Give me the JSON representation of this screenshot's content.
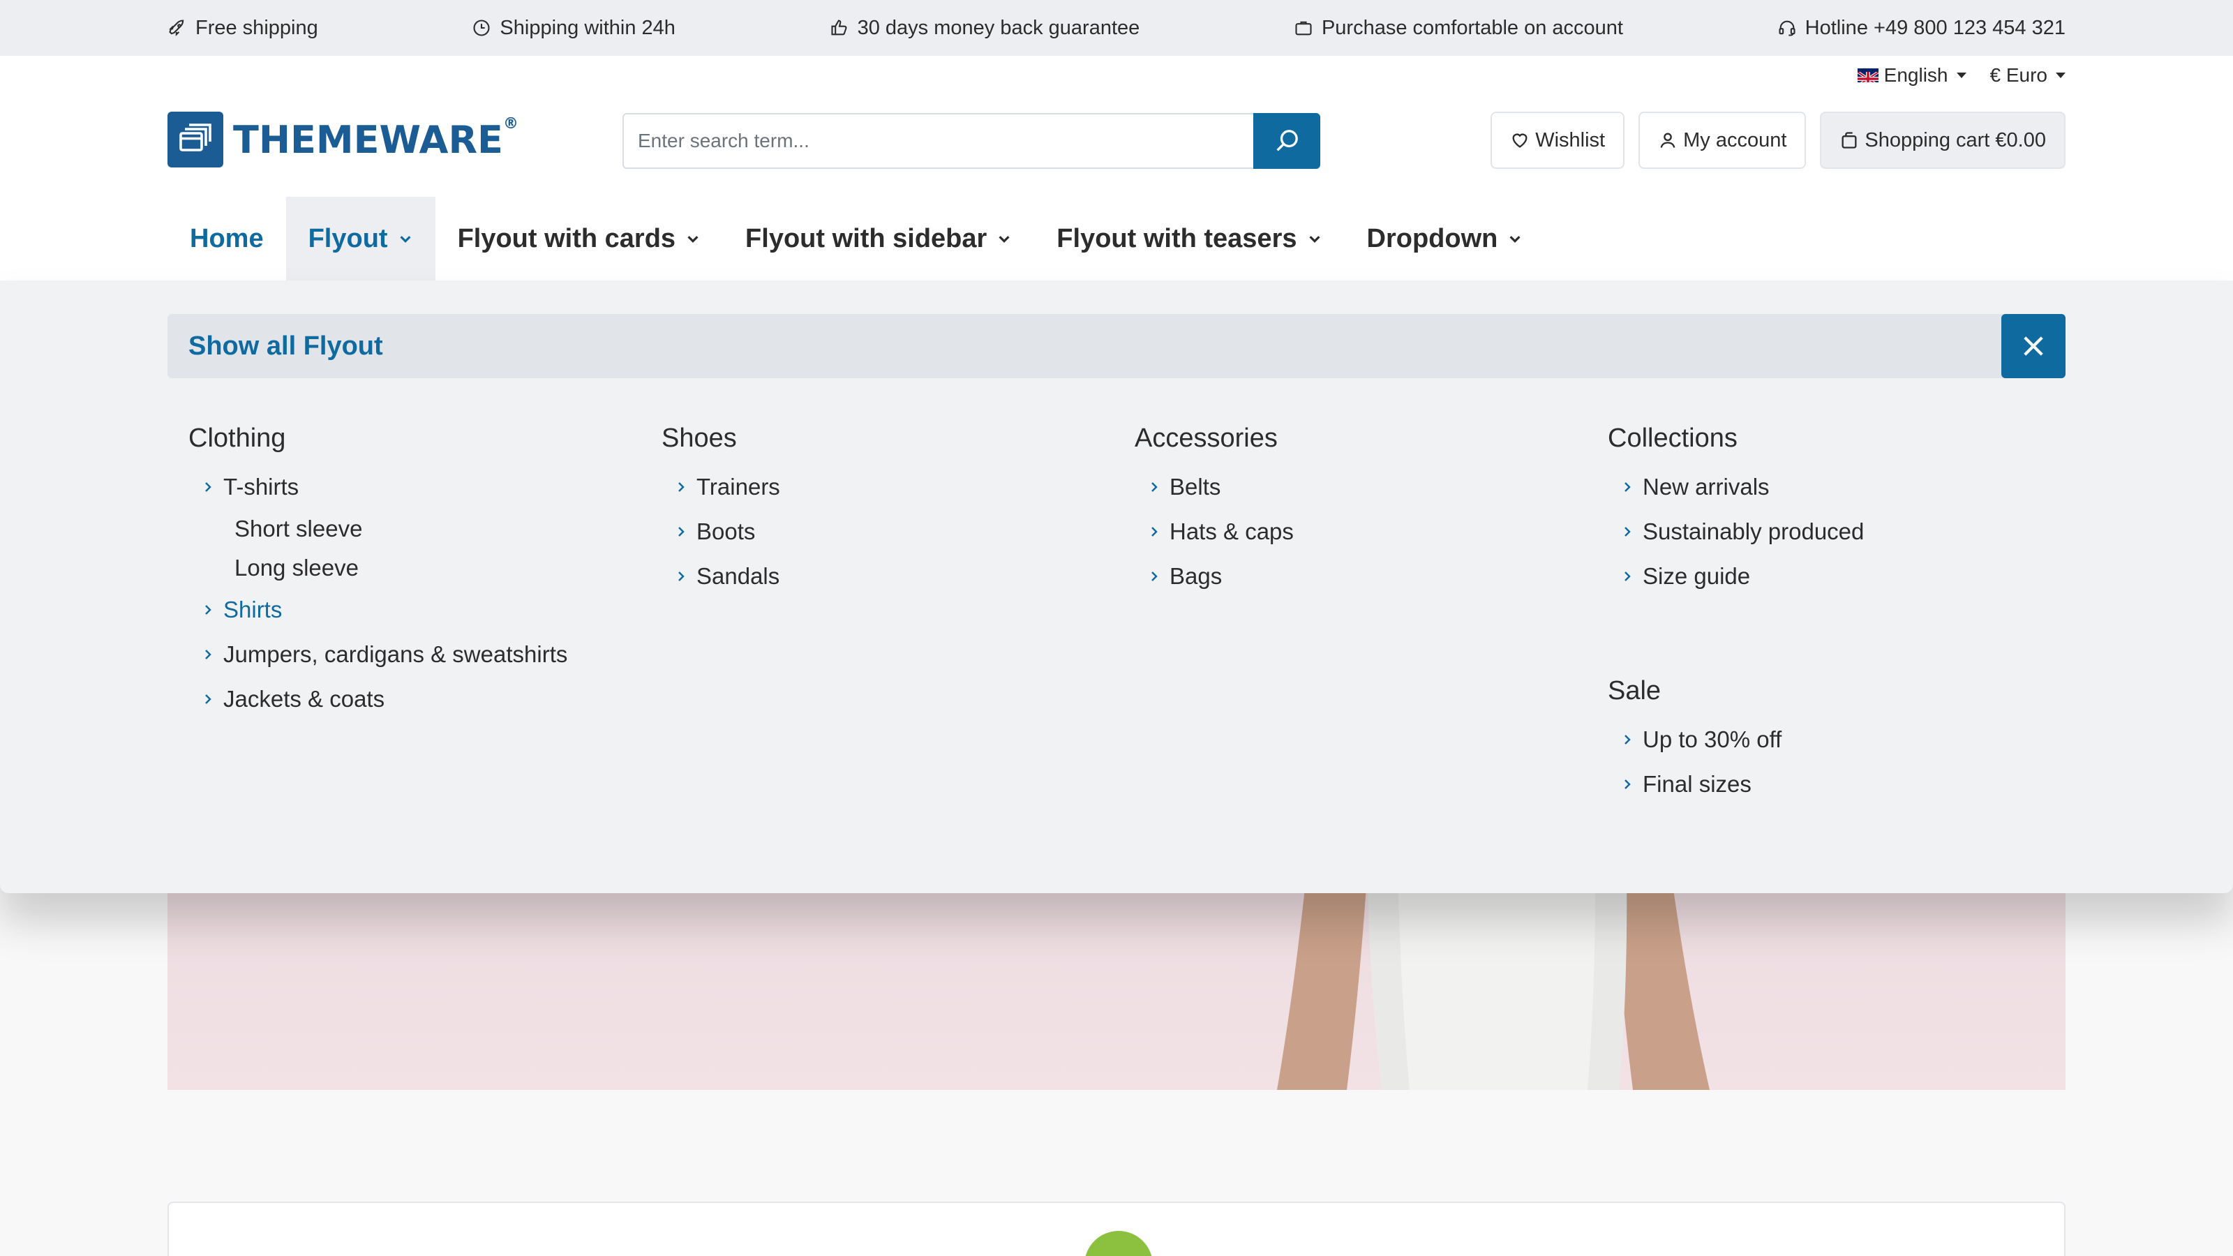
{
  "usp_bar": {
    "items": [
      {
        "icon": "rocket-icon",
        "label": "Free shipping"
      },
      {
        "icon": "clock-icon",
        "label": "Shipping within 24h"
      },
      {
        "icon": "thumbs-up-icon",
        "label": "30 days money back guarantee"
      },
      {
        "icon": "briefcase-icon",
        "label": "Purchase comfortable on account"
      },
      {
        "icon": "headset-icon",
        "label": "Hotline +49 800 123 454 321"
      }
    ]
  },
  "meta_nav": {
    "language": "English",
    "currency": "€ Euro"
  },
  "logo": {
    "text": "THEMEWARE",
    "registered": "®"
  },
  "search": {
    "placeholder": "Enter search term..."
  },
  "actions": {
    "wishlist": "Wishlist",
    "account": "My account",
    "cart": "Shopping cart €0.00"
  },
  "main_nav": [
    {
      "label": "Home"
    },
    {
      "label": "Flyout"
    },
    {
      "label": "Flyout with cards"
    },
    {
      "label": "Flyout with sidebar"
    },
    {
      "label": "Flyout with teasers"
    },
    {
      "label": "Dropdown"
    }
  ],
  "flyout": {
    "show_all": "Show all Flyout",
    "columns": [
      {
        "title": "Clothing",
        "items": [
          {
            "label": "T-shirts",
            "children": [
              "Short sleeve",
              "Long sleeve"
            ]
          },
          {
            "label": "Shirts"
          },
          {
            "label": "Jumpers, cardigans & sweatshirts"
          },
          {
            "label": "Jackets & coats"
          }
        ]
      },
      {
        "title": "Shoes",
        "items": [
          {
            "label": "Trainers"
          },
          {
            "label": "Boots"
          },
          {
            "label": "Sandals"
          }
        ]
      },
      {
        "title": "Accessories",
        "items": [
          {
            "label": "Belts"
          },
          {
            "label": "Hats & caps"
          },
          {
            "label": "Bags"
          }
        ]
      },
      {
        "title": "Collections",
        "items": [
          {
            "label": "New arrivals"
          },
          {
            "label": "Sustainably produced"
          },
          {
            "label": "Size guide"
          }
        ]
      },
      {
        "title": "Sale",
        "items": [
          {
            "label": "Up to 30% off"
          },
          {
            "label": "Final sizes"
          }
        ]
      }
    ]
  },
  "colors": {
    "primary": "#0f6aa0",
    "brand": "#1b5c94",
    "usp_bg": "#eceef1",
    "flyout_bg": "#f1f2f4",
    "badge_green": "#8cc03f"
  }
}
